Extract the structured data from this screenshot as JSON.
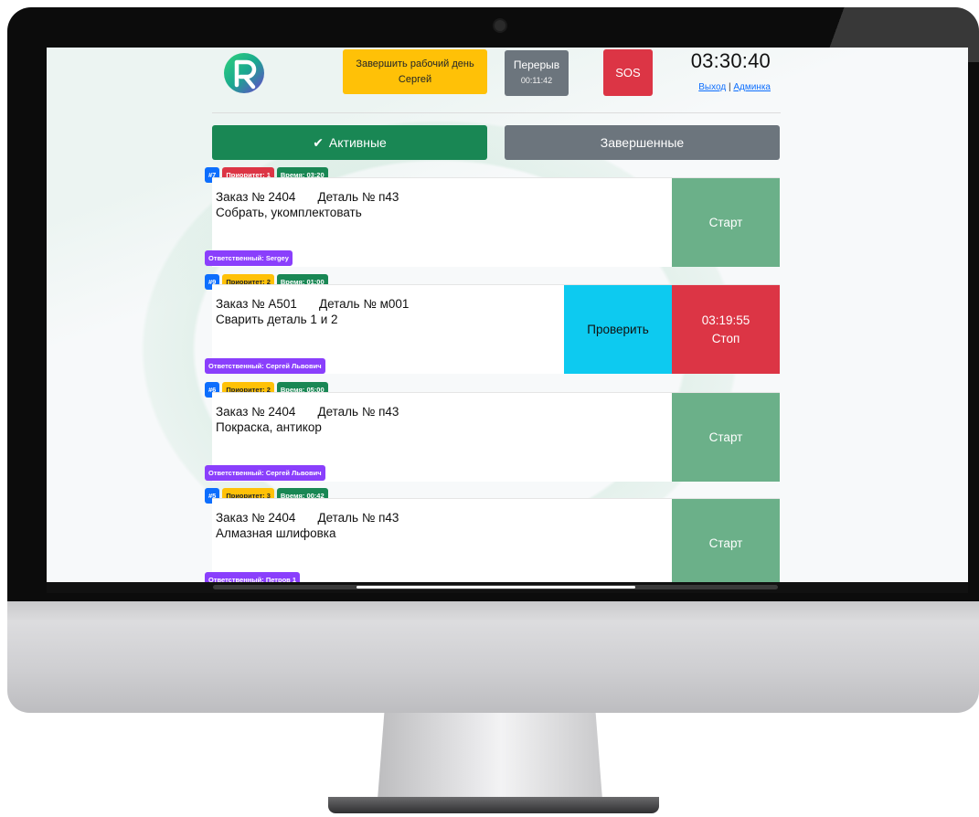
{
  "header": {
    "end_day_line1": "Завершить рабочий день",
    "end_day_line2": "Сергей",
    "break_label": "Перерыв",
    "break_time": "00:11:42",
    "sos_label": "SOS",
    "clock": "03:30:40",
    "logout_link": "Выход",
    "separator": " | ",
    "admin_link": "Админка"
  },
  "tabs": {
    "active_label": "Активные",
    "done_label": "Завершенные"
  },
  "colors": {
    "active_tab": "#198754",
    "start_button": "#6bb089",
    "stop_button": "#dc3545",
    "check_button": "#0dcaf0",
    "responsible_badge": "#8a3ffc"
  },
  "tasks": [
    {
      "id": "#7",
      "priority": "Приоритет: 1",
      "time": "Время: 03:20",
      "order": "Заказ № 2404",
      "part": "Деталь № п43",
      "operation": "Собрать, укомплектовать",
      "responsible": "Ответственный: Sergey",
      "start_label": "Старт"
    },
    {
      "id": "#9",
      "priority": "Приоритет: 2",
      "time": "Время: 01:00",
      "order": "Заказ № А501",
      "part": "Деталь № м001",
      "operation": "Сварить деталь 1 и 2",
      "responsible": "Ответственный: Сергей Львович",
      "check_label": "Проверить",
      "timer": "03:19:55",
      "stop_label": "Стоп"
    },
    {
      "id": "#6",
      "priority": "Приоритет: 2",
      "time": "Время: 05:00",
      "order": "Заказ № 2404",
      "part": "Деталь № п43",
      "operation": "Покраска, антикор",
      "responsible": "Ответственный: Сергей Львович",
      "start_label": "Старт"
    },
    {
      "id": "#5",
      "priority": "Приоритет: 3",
      "time": "Время: 00:42",
      "order": "Заказ № 2404",
      "part": "Деталь № п43",
      "operation": "Алмазная шлифовка",
      "responsible": "Ответственный: Петров 1",
      "start_label": "Старт"
    }
  ]
}
